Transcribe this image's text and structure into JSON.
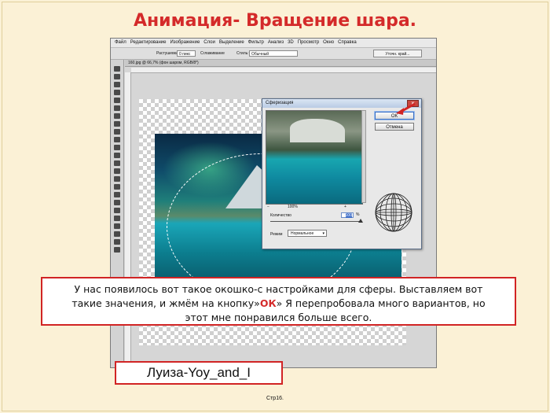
{
  "slide": {
    "title": "Анимация- Вращение шара.",
    "page_number": "Стр16.",
    "author": "Луиза-Yoy_and_I",
    "callout": {
      "part1": "У нас появилось вот такое окошко-с настройками для сферы. Выставляем вот такие значения, и жмём на кнопку»",
      "ok_word": "ОК",
      "part2": "» Я перепробовала много вариантов, но этот мне понравился больше всего."
    }
  },
  "app": {
    "menu": [
      "Файл",
      "Редактирование",
      "Изображение",
      "Слои",
      "Выделение",
      "Фильтр",
      "Анализ",
      "3D",
      "Просмотр",
      "Окно",
      "Справка"
    ],
    "options": {
      "feather_label": "Растушевка:",
      "feather_value": "0 пикс",
      "antialias_label": "Сглаживание",
      "style_label": "Стиль:",
      "style_value": "Обычный",
      "refine_edge_button": "Уточн. край..."
    },
    "doc_tab": "160.jpg @ 66,7% (фон шаром, RGB/8*)"
  },
  "dialog": {
    "title": "Сферизация",
    "close": "✕",
    "ok_button": "ОК",
    "cancel_button": "Отмена",
    "zoom_minus": "−",
    "zoom_value": "100%",
    "zoom_plus": "+",
    "amount_label": "Количество",
    "amount_value": "100",
    "amount_unit": "%",
    "amount_fraction": 1.0,
    "mode_label": "Режим",
    "mode_value": "Нормальное",
    "mode_arrow": "▾"
  },
  "colors": {
    "title_red": "#d42a2a",
    "frame_red": "#d12424",
    "slide_bg": "#fbf1d6"
  }
}
